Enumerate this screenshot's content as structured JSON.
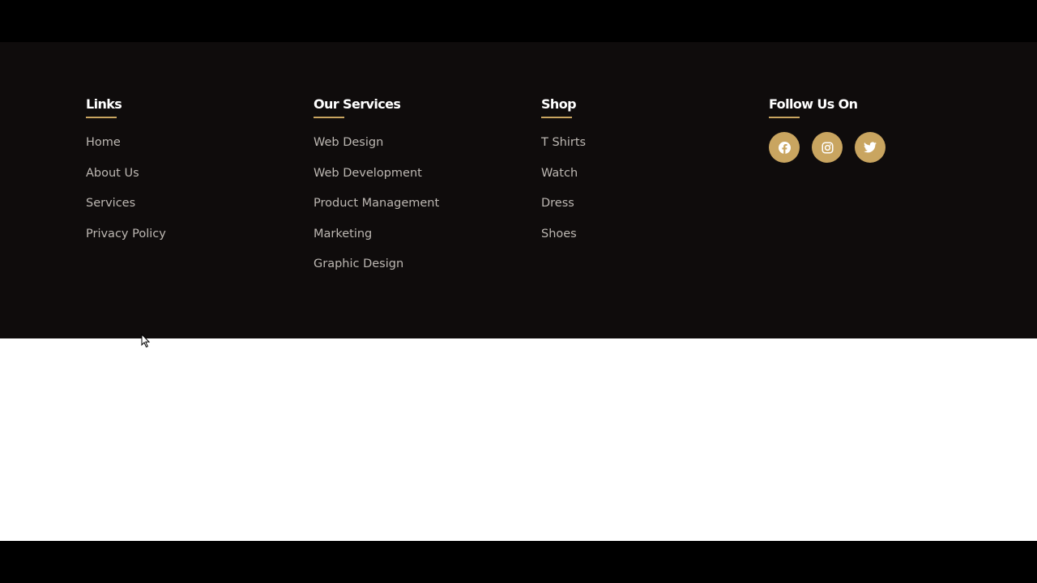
{
  "footer": {
    "columns": [
      {
        "title": "Links",
        "items": [
          "Home",
          "About Us",
          "Services",
          "Privacy Policy"
        ]
      },
      {
        "title": "Our Services",
        "items": [
          "Web Design",
          "Web Development",
          "Product Management",
          "Marketing",
          "Graphic Design"
        ]
      },
      {
        "title": "Shop",
        "items": [
          "T Shirts",
          "Watch",
          "Dress",
          "Shoes"
        ]
      }
    ],
    "follow": {
      "title": "Follow Us On",
      "icons": [
        "facebook-icon",
        "instagram-icon",
        "twitter-icon"
      ]
    }
  },
  "colors": {
    "footer_bg": "#0f0c0c",
    "accent": "#c9a560",
    "link_text": "#bdb8b3",
    "heading_text": "#ffffff",
    "page_bg": "#ffffff"
  }
}
